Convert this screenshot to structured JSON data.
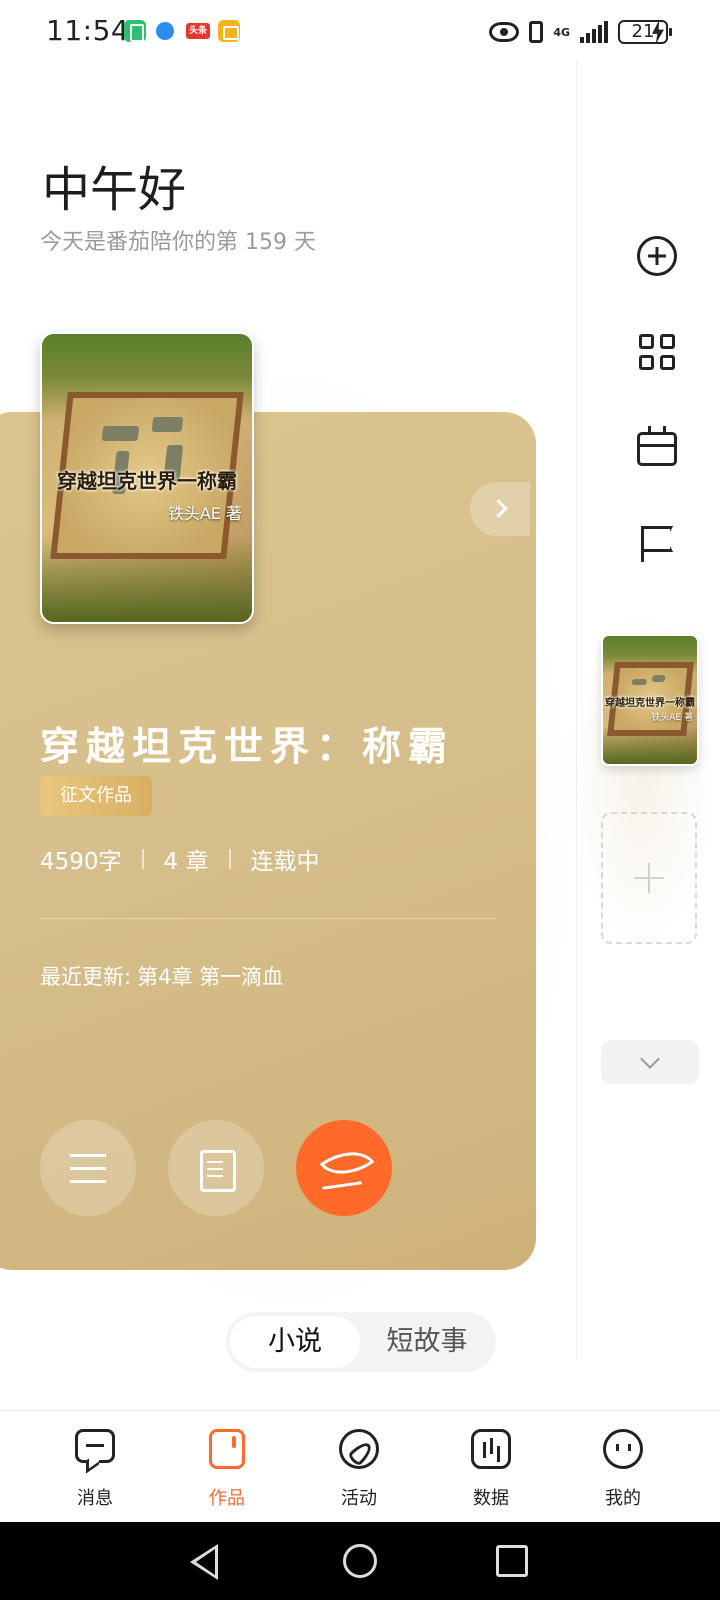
{
  "status_bar": {
    "time": "11:54",
    "network": "4G",
    "battery": "21",
    "notif_toutiao": "头条"
  },
  "header": {
    "greeting": "中午好",
    "subtitle": "今天是番茄陪你的第 159 天"
  },
  "book": {
    "cover_title": "穿越坦克世界一称霸",
    "cover_author": "铁头AE 著",
    "title": "穿越坦克世界：称霸",
    "tag": "征文作品",
    "word_count": "4590字",
    "chapters": "4 章",
    "status": "连载中",
    "latest_label": "最近更新:",
    "latest_chapter": "第4章 第一滴血"
  },
  "segment": {
    "options": [
      "小说",
      "短故事"
    ],
    "selected": "小说"
  },
  "bottom_nav": {
    "items": [
      {
        "label": "消息",
        "icon": "message-icon"
      },
      {
        "label": "作品",
        "icon": "works-icon"
      },
      {
        "label": "活动",
        "icon": "compass-icon"
      },
      {
        "label": "数据",
        "icon": "stats-icon"
      },
      {
        "label": "我的",
        "icon": "profile-icon"
      }
    ],
    "active": "作品"
  },
  "colors": {
    "accent": "#ff6a2a",
    "card": "#d6bf8c",
    "tag": "#e0bc70"
  }
}
